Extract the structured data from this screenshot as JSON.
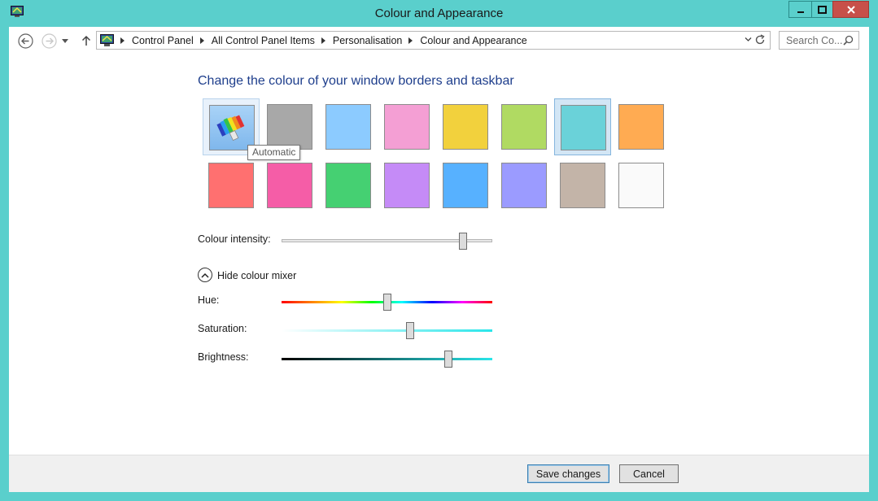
{
  "window": {
    "title": "Colour and Appearance",
    "controls": {
      "minimize": "minimize",
      "maximize": "maximize",
      "close": "close"
    }
  },
  "nav": {
    "breadcrumbs": [
      "Control Panel",
      "All Control Panel Items",
      "Personalisation",
      "Colour and Appearance"
    ],
    "search_placeholder": "Search Co..."
  },
  "main": {
    "heading": "Change the colour of your window borders and taskbar",
    "swatches_row1": [
      "automatic",
      "#a8a8a8",
      "#8ccbff",
      "#f49fd4",
      "#f2d13d",
      "#b0da62",
      "#6ad2d9",
      "#ffab52"
    ],
    "swatches_row2": [
      "#ff7070",
      "#f55da7",
      "#45d072",
      "#c58bf7",
      "#57b1ff",
      "#9b9bff",
      "#c3b4a8",
      "#fafafa"
    ],
    "selected_index": 6,
    "tooltip": "Automatic",
    "intensity_label": "Colour intensity:",
    "intensity_value": 0.86,
    "mixer_toggle": "Hide colour mixer",
    "hue_label": "Hue:",
    "hue_value": 0.5,
    "saturation_label": "Saturation:",
    "saturation_value": 0.61,
    "brightness_label": "Brightness:",
    "brightness_value": 0.79
  },
  "footer": {
    "save_label": "Save changes",
    "cancel_label": "Cancel"
  },
  "colors": {
    "window_frame": "#5acfcc",
    "accent": "#1e3e8c",
    "close_button": "#c7504a"
  }
}
